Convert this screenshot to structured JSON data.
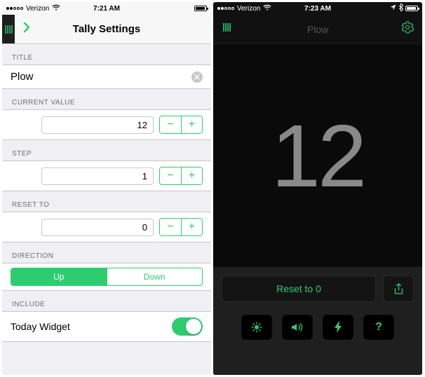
{
  "colors": {
    "accent": "#2ecc71"
  },
  "left": {
    "status": {
      "carrier": "Verizon",
      "time": "7:21 AM",
      "signal_filled": 2
    },
    "nav_title": "Tally Settings",
    "sections": {
      "title_label": "TITLE",
      "title_value": "Plow",
      "current_value_label": "CURRENT VALUE",
      "current_value": "12",
      "step_label": "STEP",
      "step_value": "1",
      "reset_to_label": "RESET TO",
      "reset_to_value": "0",
      "direction_label": "DIRECTION",
      "direction_options": {
        "up": "Up",
        "down": "Down"
      },
      "include_label": "INCLUDE",
      "today_widget_label": "Today Widget"
    }
  },
  "right": {
    "status": {
      "carrier": "Verizon",
      "time": "7:23 AM",
      "signal_filled": 2
    },
    "nav_title": "Plow",
    "count": "12",
    "reset_label": "Reset to 0",
    "icons": {
      "brightness": "brightness",
      "sound": "sound",
      "flash": "flash",
      "help": "?"
    }
  }
}
